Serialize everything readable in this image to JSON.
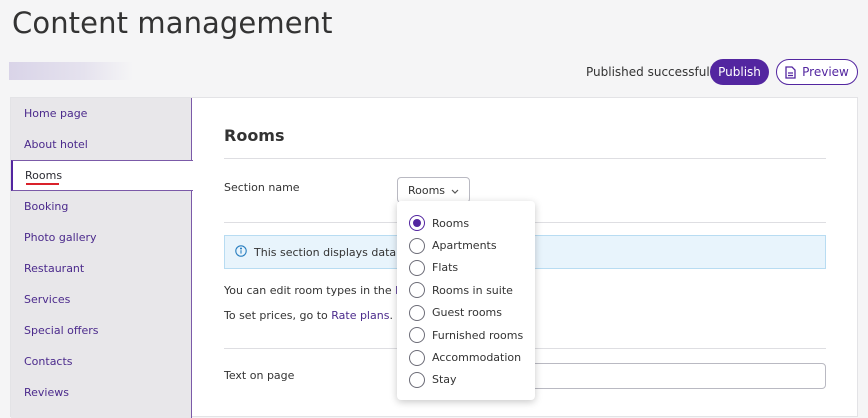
{
  "header": {
    "title": "Content management",
    "status": "Published successfully",
    "publish_label": "Publish",
    "preview_label": "Preview"
  },
  "sidebar": {
    "items": [
      {
        "label": "Home page"
      },
      {
        "label": "About hotel"
      },
      {
        "label": "Rooms",
        "active": true
      },
      {
        "label": "Booking"
      },
      {
        "label": "Photo gallery"
      },
      {
        "label": "Restaurant"
      },
      {
        "label": "Services"
      },
      {
        "label": "Special offers"
      },
      {
        "label": "Contacts"
      },
      {
        "label": "Reviews"
      }
    ]
  },
  "main": {
    "section_title": "Rooms",
    "section_name_label": "Section name",
    "section_name_value": "Rooms",
    "info_text": "This section displays data fr",
    "edit_text_prefix": "You can edit room types in the ",
    "edit_link_partial": "Ro",
    "prices_text_prefix": "To set prices, go to ",
    "prices_link": "Rate plans",
    "prices_text_suffix": ".",
    "text_on_page_label": "Text on page"
  },
  "dropdown": {
    "options": [
      {
        "label": "Rooms",
        "selected": true
      },
      {
        "label": "Apartments",
        "selected": false
      },
      {
        "label": "Flats",
        "selected": false
      },
      {
        "label": "Rooms in suite",
        "selected": false
      },
      {
        "label": "Guest rooms",
        "selected": false
      },
      {
        "label": "Furnished rooms",
        "selected": false
      },
      {
        "label": "Accommodation",
        "selected": false
      },
      {
        "label": "Stay",
        "selected": false
      }
    ]
  },
  "colors": {
    "accent": "#5326a0",
    "active_marker": "#d9212a",
    "info_bg": "#e8f4fc"
  }
}
